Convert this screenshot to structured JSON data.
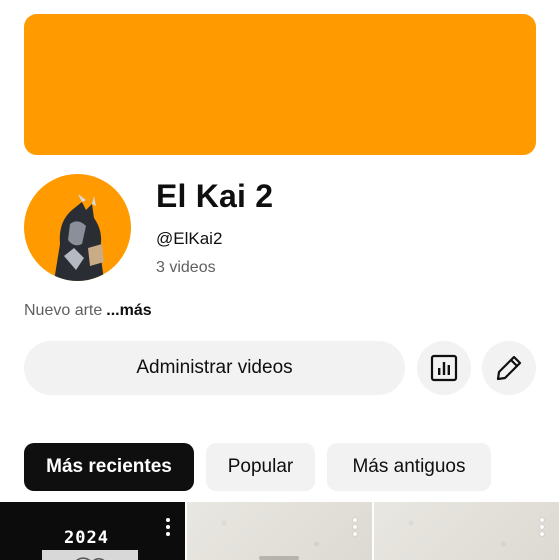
{
  "colors": {
    "banner": "#ff9a00",
    "avatar_bg": "#ff9a00",
    "chip_active_bg": "#0f0f0f",
    "chip_bg": "#f2f2f2"
  },
  "channel": {
    "name": "El Kai 2",
    "handle": "@ElKai2",
    "video_count": "3 videos"
  },
  "description": {
    "text": "Nuevo arte",
    "more_label": "...más"
  },
  "actions": {
    "manage_label": "Administrar videos",
    "analytics_icon": "bar-chart-icon",
    "edit_icon": "pencil-icon"
  },
  "chips": {
    "recent": "Más recientes",
    "popular": "Popular",
    "oldest": "Más antiguos",
    "selected": "Más recientes"
  },
  "thumbnails": [
    {
      "overlay_text": "2024",
      "menu_icon": "more-vert-icon"
    },
    {
      "menu_icon": "more-vert-icon"
    },
    {
      "menu_icon": "more-vert-icon"
    }
  ]
}
